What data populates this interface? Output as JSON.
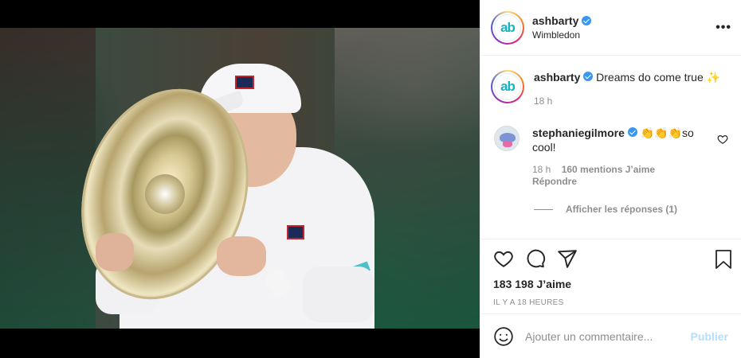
{
  "post": {
    "username": "ashbarty",
    "location": "Wimbledon",
    "avatar_text": "ab",
    "more_icon": "•••",
    "caption": "Dreams do come true ✨",
    "caption_age": "18 h"
  },
  "comment": {
    "username": "stephaniegilmore",
    "text": "👏👏👏so cool!",
    "age": "18 h",
    "likes": "160 mentions J’aime",
    "reply_label": "Répondre",
    "view_replies": "Afficher les réponses (1)"
  },
  "actions": {
    "likes_count": "183 198 J’aime",
    "timestamp": "IL Y A 18 HEURES"
  },
  "composer": {
    "placeholder": "Ajouter un commentaire...",
    "post_label": "Publier"
  },
  "colors": {
    "link": "#b2dffc",
    "verified": "#3897f0",
    "brand": "#16b3c1"
  }
}
